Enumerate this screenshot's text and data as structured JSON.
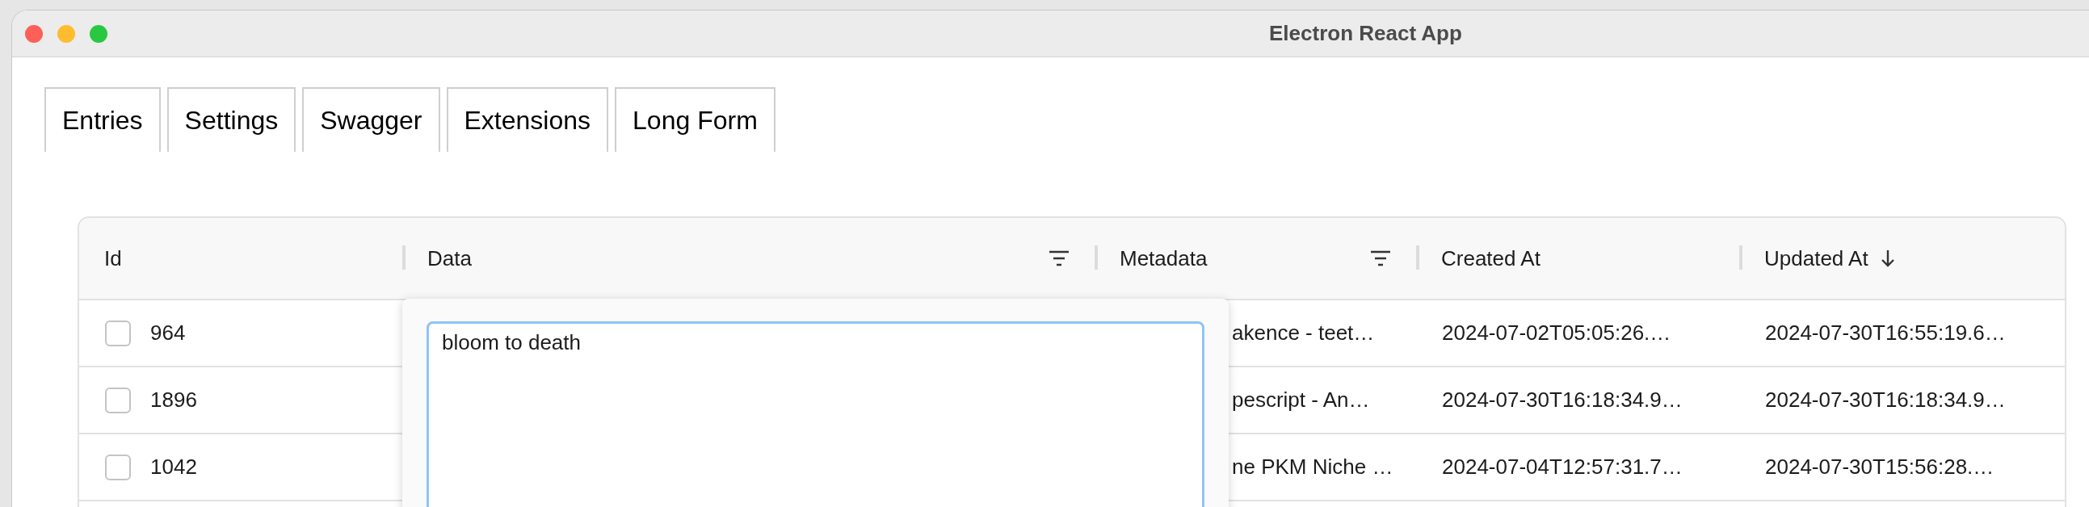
{
  "window": {
    "title": "Electron React App"
  },
  "tabs": [
    {
      "label": "Entries"
    },
    {
      "label": "Settings"
    },
    {
      "label": "Swagger"
    },
    {
      "label": "Extensions"
    },
    {
      "label": "Long Form"
    }
  ],
  "table": {
    "columns": [
      {
        "label": "Id",
        "filter": false,
        "sorted": false
      },
      {
        "label": "Data",
        "filter": true,
        "sorted": false
      },
      {
        "label": "Metadata",
        "filter": true,
        "sorted": false
      },
      {
        "label": "Created At",
        "filter": false,
        "sorted": false
      },
      {
        "label": "Updated At",
        "filter": false,
        "sorted": true
      }
    ],
    "rows": [
      {
        "id": "964",
        "checked": false,
        "metadata": "akence - teet…",
        "created_at": "2024-07-02T05:05:26.…",
        "updated_at": "2024-07-30T16:55:19.6…"
      },
      {
        "id": "1896",
        "checked": false,
        "metadata": "pescript - An…",
        "created_at": "2024-07-30T16:18:34.9…",
        "updated_at": "2024-07-30T16:18:34.9…"
      },
      {
        "id": "1042",
        "checked": false,
        "metadata": "ne PKM Niche …",
        "created_at": "2024-07-04T12:57:31.7…",
        "updated_at": "2024-07-30T15:56:28.…"
      }
    ]
  },
  "editor": {
    "value": "bloom to death"
  }
}
